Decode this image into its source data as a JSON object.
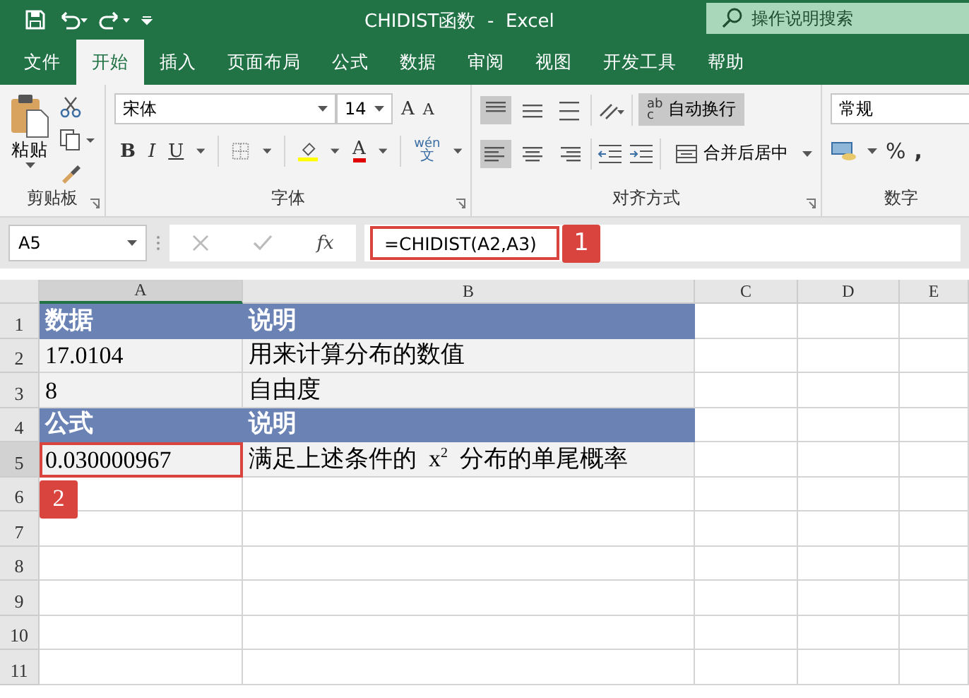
{
  "window": {
    "title": "CHIDIST函数  -  Excel",
    "search_placeholder": "操作说明搜索"
  },
  "ribbon_tabs": [
    {
      "label": "文件",
      "selected": false
    },
    {
      "label": "开始",
      "selected": true
    },
    {
      "label": "插入",
      "selected": false
    },
    {
      "label": "页面布局",
      "selected": false
    },
    {
      "label": "公式",
      "selected": false
    },
    {
      "label": "数据",
      "selected": false
    },
    {
      "label": "审阅",
      "selected": false
    },
    {
      "label": "视图",
      "selected": false
    },
    {
      "label": "开发工具",
      "selected": false
    },
    {
      "label": "帮助",
      "selected": false
    }
  ],
  "clipboard": {
    "paste": "粘贴",
    "label": "剪贴板"
  },
  "font": {
    "name": "宋体",
    "size": "14",
    "grow": "A",
    "shrink": "A",
    "bold": "B",
    "italic": "I",
    "underline": "U",
    "font_color": "A",
    "phonetic_top": "wén",
    "phonetic_bottom": "文",
    "label": "字体"
  },
  "alignment": {
    "top_align_selected": true,
    "left_align_selected": true,
    "wrap_text": {
      "label": "自动换行",
      "icon_top": "ab",
      "icon_bottom": "c",
      "selected": true
    },
    "merge_center": "合并后居中",
    "label": "对齐方式"
  },
  "number": {
    "format": "常规",
    "percent": "%",
    "comma": ",",
    "label": "数字"
  },
  "formula_bar": {
    "name_box": "A5",
    "fx": "fx",
    "formula": "=CHIDIST(A2,A3)",
    "callout": "1"
  },
  "sheet": {
    "columns": [
      {
        "label": "A",
        "selected": true
      },
      {
        "label": "B",
        "selected": false
      },
      {
        "label": "C",
        "selected": false
      },
      {
        "label": "D",
        "selected": false
      },
      {
        "label": "E",
        "selected": false
      }
    ],
    "rows": [
      {
        "number": "1",
        "kind": "header",
        "selected": false,
        "cells": [
          "数据",
          "说明"
        ]
      },
      {
        "number": "2",
        "kind": "data",
        "selected": false,
        "cells": [
          "17.0104",
          "用来计算分布的数值"
        ]
      },
      {
        "number": "3",
        "kind": "data",
        "selected": false,
        "cells": [
          "8",
          "自由度"
        ]
      },
      {
        "number": "4",
        "kind": "header",
        "selected": false,
        "cells": [
          "公式",
          "说明"
        ]
      },
      {
        "number": "5",
        "kind": "data",
        "selected": true,
        "cells": [
          "0.030000967",
          "满足上述条件的  x$^{2}$  分布的单尾概率"
        ]
      },
      {
        "number": "6",
        "kind": "empty",
        "selected": false,
        "cells": []
      },
      {
        "number": "7",
        "kind": "empty",
        "selected": false,
        "cells": []
      },
      {
        "number": "8",
        "kind": "empty",
        "selected": false,
        "cells": []
      },
      {
        "number": "9",
        "kind": "empty",
        "selected": false,
        "cells": []
      },
      {
        "number": "10",
        "kind": "empty",
        "selected": false,
        "cells": []
      },
      {
        "number": "11",
        "kind": "empty",
        "selected": false,
        "cells": []
      }
    ],
    "callout": "2"
  }
}
